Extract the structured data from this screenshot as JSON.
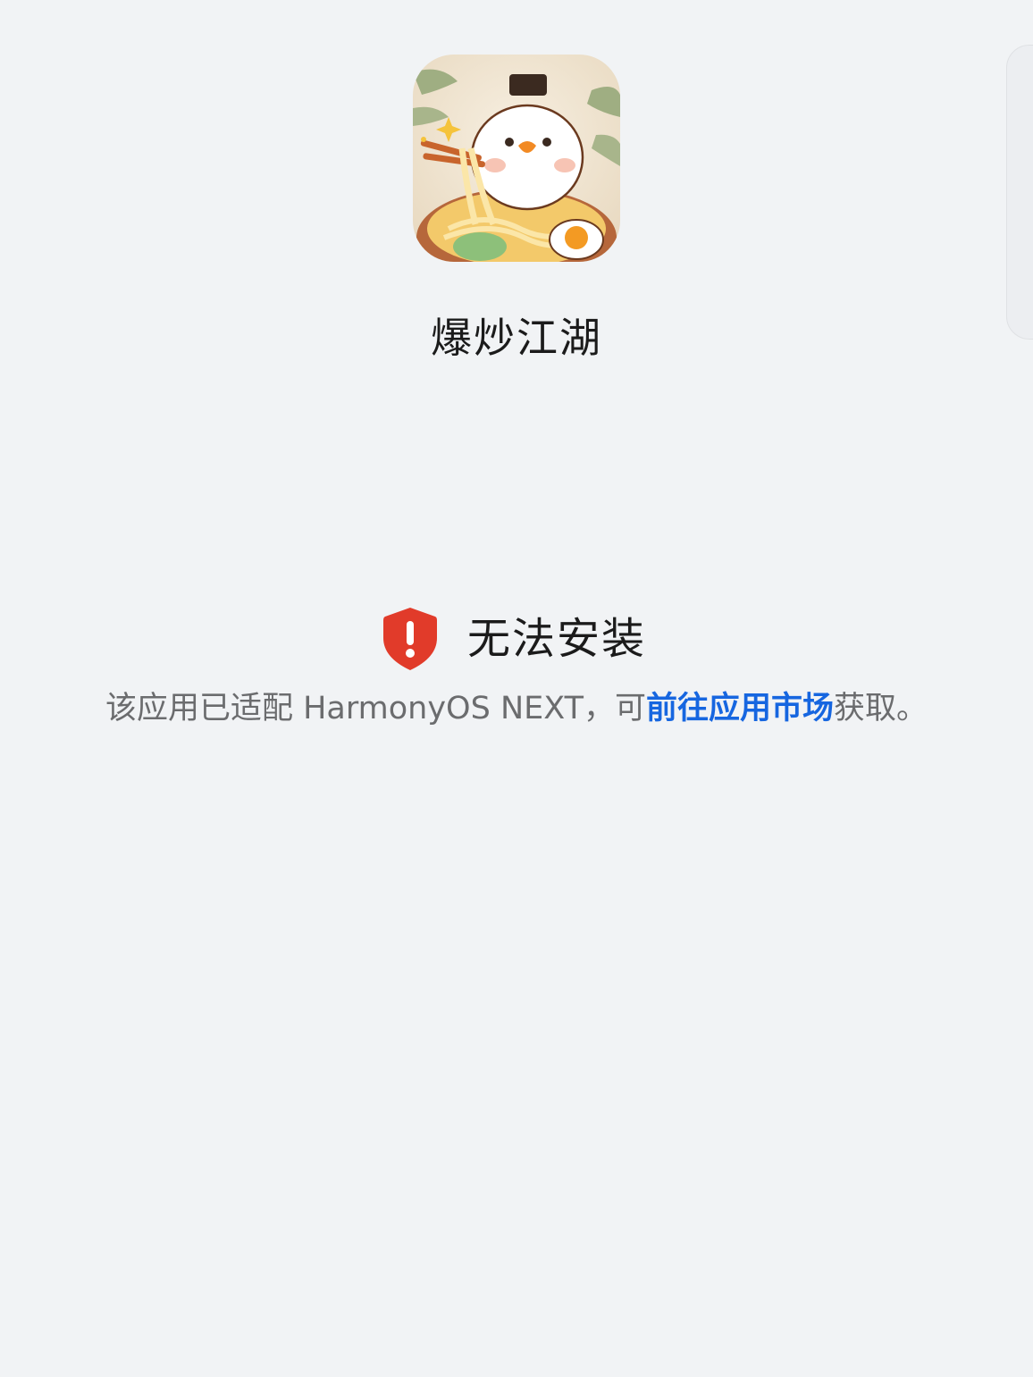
{
  "app": {
    "name": "爆炒江湖",
    "icon": "app-icon-noodle-chef-bun"
  },
  "status": {
    "icon": "shield-warning-icon",
    "title": "无法安装"
  },
  "message": {
    "prefix": "该应用已适配 HarmonyOS NEXT，可",
    "link": "前往应用市场",
    "suffix": "获取。"
  },
  "colors": {
    "background": "#f1f3f5",
    "link": "#1666e0",
    "warning": "#e13b2a",
    "text_primary": "#1b1b1b",
    "text_secondary": "#6b6c6e"
  }
}
